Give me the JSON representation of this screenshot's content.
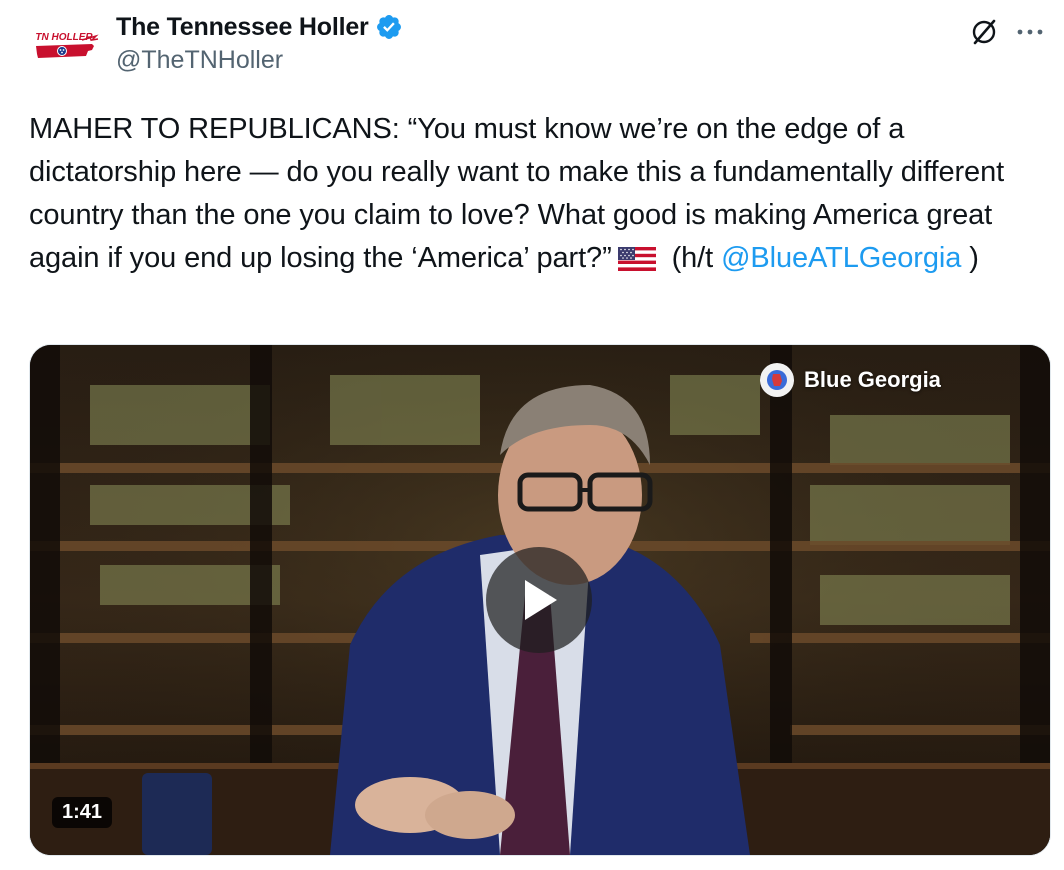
{
  "author": {
    "display_name": "The Tennessee Holler",
    "handle": "@TheTNHoller",
    "avatar_logo_text": "TN HOLLER",
    "verified": true
  },
  "tweet": {
    "text_main": "MAHER TO REPUBLICANS: “You must know we’re on the edge of a dictatorship here — do you really want to make this a fundamentally different country than the one you claim to love? What good is making America great again if you end up losing the ‘America’ part?”",
    "text_after_flag": "(h/t",
    "mention": "@BlueATLGeorgia",
    "closing": ")",
    "flag_emoji": "us-flag-icon"
  },
  "media": {
    "type": "video",
    "watermark": "Blue Georgia",
    "duration": "1:41"
  },
  "colors": {
    "text": "#0f1419",
    "secondary": "#536471",
    "link": "#1d9bf0",
    "verified": "#1d9bf0"
  }
}
